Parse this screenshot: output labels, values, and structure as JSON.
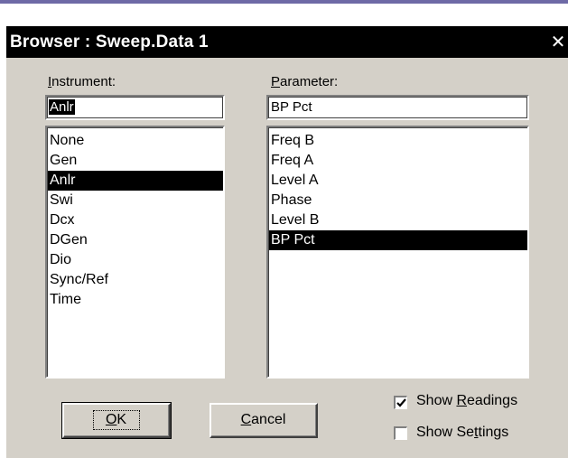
{
  "window": {
    "title": "Browser : Sweep.Data 1",
    "close_glyph": "✕"
  },
  "instrument": {
    "label_accel": "I",
    "label_rest": "nstrument:",
    "value": "Anlr",
    "items": [
      "None",
      "Gen",
      "Anlr",
      "Swi",
      "Dcx",
      "DGen",
      "Dio",
      "Sync/Ref",
      "Time"
    ],
    "selected_index": 2
  },
  "parameter": {
    "label_accel": "P",
    "label_rest": "arameter:",
    "value": "BP Pct",
    "items": [
      "Freq B",
      "Freq A",
      "Level A",
      "Phase",
      "Level B",
      "BP Pct"
    ],
    "selected_index": 5
  },
  "buttons": {
    "ok_accel": "O",
    "ok_rest": "K",
    "cancel_accel": "C",
    "cancel_rest": "ancel"
  },
  "checkboxes": {
    "show_readings": {
      "pre": "Show ",
      "accel": "R",
      "post": "eadings",
      "checked": true
    },
    "show_settings": {
      "pre": "Show Se",
      "accel": "t",
      "post": "tings",
      "checked": false
    }
  },
  "colors": {
    "accent_line": "#6e6aa6",
    "dialog_face": "#d4d0c8",
    "titlebar": "#000000",
    "selection": "#000000"
  },
  "icons": {
    "close": "close-icon",
    "check": "checkmark-icon"
  }
}
